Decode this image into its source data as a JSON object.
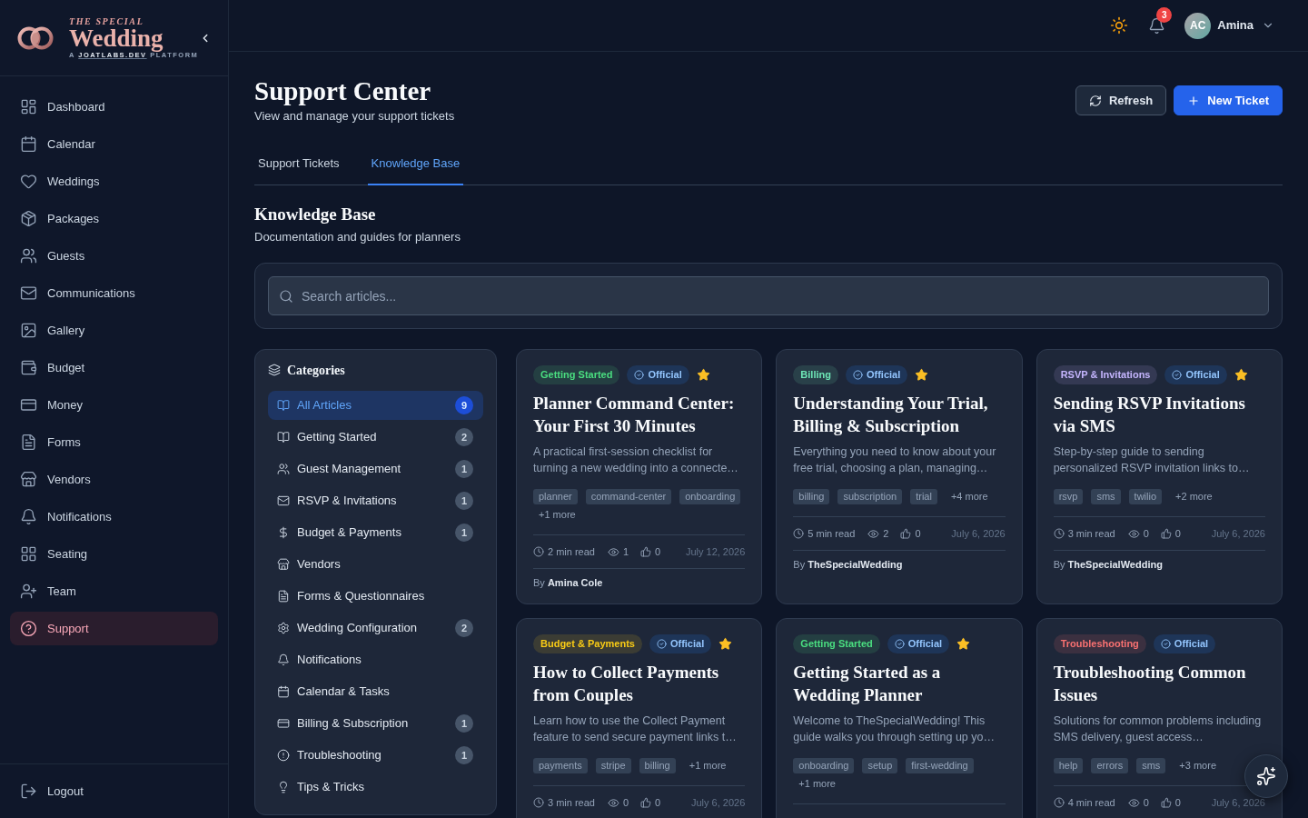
{
  "sidebar": {
    "logo": {
      "overline": "THE SPECIAL",
      "name": "Wedding",
      "tagline": {
        "before": "A",
        "link": "JOATLABS.DEV",
        "after": "PLATFORM"
      }
    },
    "items": [
      {
        "label": "Dashboard",
        "selected": false
      },
      {
        "label": "Calendar",
        "selected": false
      },
      {
        "label": "Weddings",
        "selected": false
      },
      {
        "label": "Packages",
        "selected": false
      },
      {
        "label": "Guests",
        "selected": false
      },
      {
        "label": "Communications",
        "selected": false
      },
      {
        "label": "Gallery",
        "selected": false
      },
      {
        "label": "Budget",
        "selected": false
      },
      {
        "label": "Money",
        "selected": false
      },
      {
        "label": "Forms",
        "selected": false
      },
      {
        "label": "Vendors",
        "selected": false
      },
      {
        "label": "Notifications",
        "selected": false
      },
      {
        "label": "Seating",
        "selected": false
      },
      {
        "label": "Team",
        "selected": false
      },
      {
        "label": "Support",
        "selected": true
      }
    ],
    "footer": {
      "label": "Logout"
    }
  },
  "topbar": {
    "notifications_count": "3",
    "user": {
      "initials": "AC",
      "name": "Amina"
    }
  },
  "header": {
    "title": "Support Center",
    "subtitle": "View and manage your support tickets",
    "buttons": [
      {
        "label": "Refresh",
        "kind": "secondary"
      },
      {
        "label": "New Ticket",
        "kind": "primary"
      }
    ]
  },
  "tabs": [
    {
      "label": "Support Tickets",
      "selected": false
    },
    {
      "label": "Knowledge Base",
      "selected": true
    }
  ],
  "knowledge_base": {
    "title": "Knowledge Base",
    "subtitle": "Documentation and guides for planners",
    "search": {
      "placeholder": "Search articles..."
    },
    "categories": {
      "title": "Categories",
      "items": [
        {
          "label": "All Articles",
          "count": "9",
          "selected": true
        },
        {
          "label": "Getting Started",
          "count": "2",
          "selected": false
        },
        {
          "label": "Guest Management",
          "count": "1",
          "selected": false
        },
        {
          "label": "RSVP & Invitations",
          "count": "1",
          "selected": false
        },
        {
          "label": "Budget & Payments",
          "count": "1",
          "selected": false
        },
        {
          "label": "Vendors",
          "selected": false
        },
        {
          "label": "Forms & Questionnaires",
          "selected": false
        },
        {
          "label": "Wedding Configuration",
          "count": "2",
          "selected": false
        },
        {
          "label": "Notifications",
          "selected": false
        },
        {
          "label": "Calendar & Tasks",
          "selected": false
        },
        {
          "label": "Billing & Subscription",
          "count": "1",
          "selected": false
        },
        {
          "label": "Troubleshooting",
          "count": "1",
          "selected": false
        },
        {
          "label": "Tips & Tricks",
          "selected": false
        }
      ]
    },
    "articles": [
      {
        "category": "Getting Started",
        "color": "#4ade80",
        "badge": "Official",
        "featured": true,
        "title": "Planner Command Center: Your First 30 Minutes",
        "summary": "A practical first-session checklist for turning a new wedding into a connecte…",
        "tags": [
          "planner",
          "command-center",
          "onboarding"
        ],
        "more": "+1 more",
        "stats": {
          "read_time": "2 min read",
          "views": "1",
          "likes": "0",
          "date": "July 12, 2026"
        },
        "byline": "By **Amina Cole**"
      },
      {
        "category": "Billing",
        "color": "#6ee7b7",
        "badge": "Official",
        "featured": true,
        "title": "Understanding Your Trial, Billing & Subscription",
        "summary": "Everything you need to know about your free trial, choosing a plan, managing…",
        "tags": [
          "billing",
          "subscription",
          "trial"
        ],
        "more": "+4 more",
        "stats": {
          "read_time": "5 min read",
          "views": "2",
          "likes": "0",
          "date": "July 6, 2026"
        },
        "byline": "By **TheSpecialWedding**"
      },
      {
        "category": "RSVP & Invitations",
        "color": "#c4b5fd",
        "badge": "Official",
        "featured": true,
        "title": "Sending RSVP Invitations via SMS",
        "summary": "Step-by-step guide to sending personalized RSVP invitation links to…",
        "tags": [
          "rsvp",
          "sms",
          "twilio"
        ],
        "more": "+2 more",
        "stats": {
          "read_time": "3 min read",
          "views": "0",
          "likes": "0",
          "date": "July 6, 2026"
        },
        "byline": "By **TheSpecialWedding**"
      },
      {
        "category": "Budget & Payments",
        "color": "#facc15",
        "badge": "Official",
        "featured": true,
        "title": "How to Collect Payments from Couples",
        "summary": "Learn how to use the Collect Payment feature to send secure payment links t…",
        "tags": [
          "payments",
          "stripe",
          "billing"
        ],
        "more": "+1 more",
        "stats": {
          "read_time": "3 min read",
          "views": "0",
          "likes": "0",
          "date": "July 6, 2026"
        }
      },
      {
        "category": "Getting Started",
        "color": "#4ade80",
        "badge": "Official",
        "featured": true,
        "title": "Getting Started as a Wedding Planner",
        "summary": "Welcome to TheSpecialWedding! This guide walks you through setting up yo…",
        "tags": [
          "onboarding",
          "setup",
          "first-wedding"
        ],
        "more": "+1 more"
      },
      {
        "category": "Troubleshooting",
        "color": "#f87171",
        "badge": "Official",
        "featured": false,
        "title": "Troubleshooting Common Issues",
        "summary": "Solutions for common problems including SMS delivery, guest access…",
        "tags": [
          "help",
          "errors",
          "sms"
        ],
        "more": "+3 more",
        "stats": {
          "read_time": "4 min read",
          "views": "0",
          "likes": "0",
          "date": "July 6, 2026"
        }
      }
    ]
  }
}
